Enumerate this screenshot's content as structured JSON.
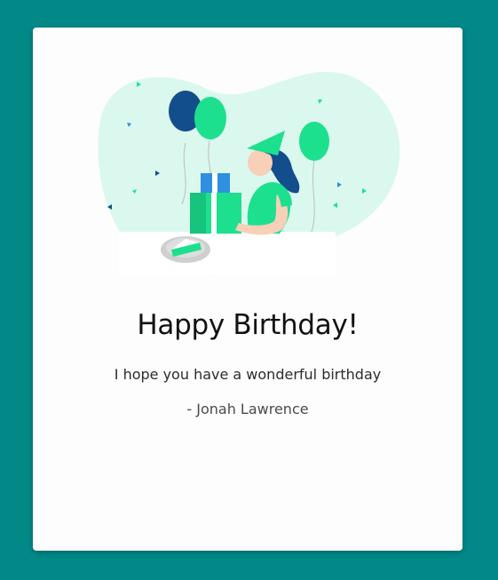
{
  "card": {
    "title": "Happy Birthday!",
    "message": "I hope you have a wonderful birthday",
    "signature": "- Jonah Lawrence"
  },
  "colors": {
    "background": "#018887",
    "card": "#fdfdfd",
    "blob": "#dbf8ee",
    "accent_green": "#1de08f",
    "balloon_blue": "#124e8c",
    "gift_blue": "#2f8fe0"
  },
  "illustration": {
    "icon": "birthday-party-illustration"
  }
}
